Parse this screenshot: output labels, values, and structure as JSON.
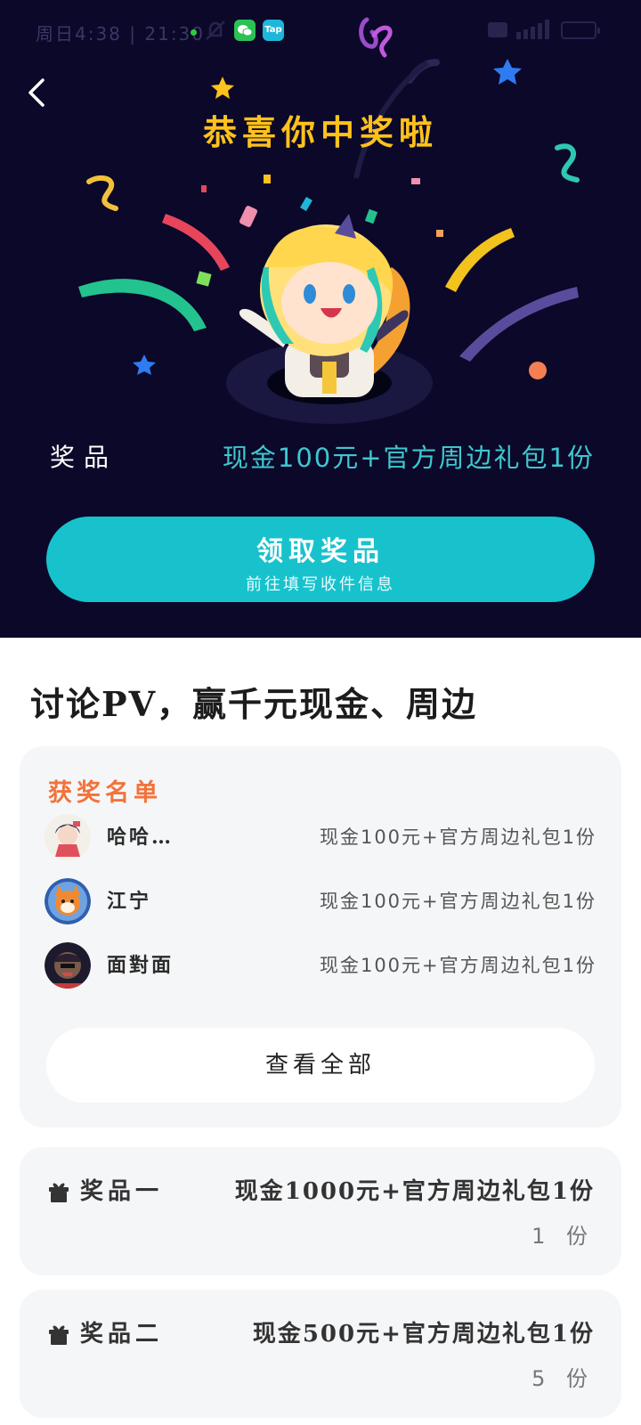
{
  "status_bar": {
    "time": "周日4:38 | 21:30",
    "tap_label": "Tap"
  },
  "hero": {
    "title": "恭喜你中奖啦",
    "prize_label": "奖品",
    "prize_value": "现金100元+官方周边礼包1份",
    "claim_button": {
      "label": "领取奖品",
      "sublabel": "前往填写收件信息"
    }
  },
  "section": {
    "title": "讨论PV，赢千元现金、周边"
  },
  "winners": {
    "heading": "获奖名单",
    "items": [
      {
        "name": "哈哈…",
        "prize": "现金100元+官方周边礼包1份"
      },
      {
        "name": "江宁",
        "prize": "现金100元+官方周边礼包1份"
      },
      {
        "name": "面對面",
        "prize": "现金100元+官方周边礼包1份"
      }
    ],
    "view_all": "查看全部"
  },
  "prizes": [
    {
      "tier": "奖品一",
      "prize": "现金1000元+官方周边礼包1份",
      "count": "1 份"
    },
    {
      "tier": "奖品二",
      "prize": "现金500元+官方周边礼包1份",
      "count": "5 份"
    }
  ],
  "colors": {
    "hero_bg": "#0b0829",
    "accent_teal": "#17c2cc",
    "title_gold": "#ffc21c",
    "winners_heading": "#f1733a"
  }
}
